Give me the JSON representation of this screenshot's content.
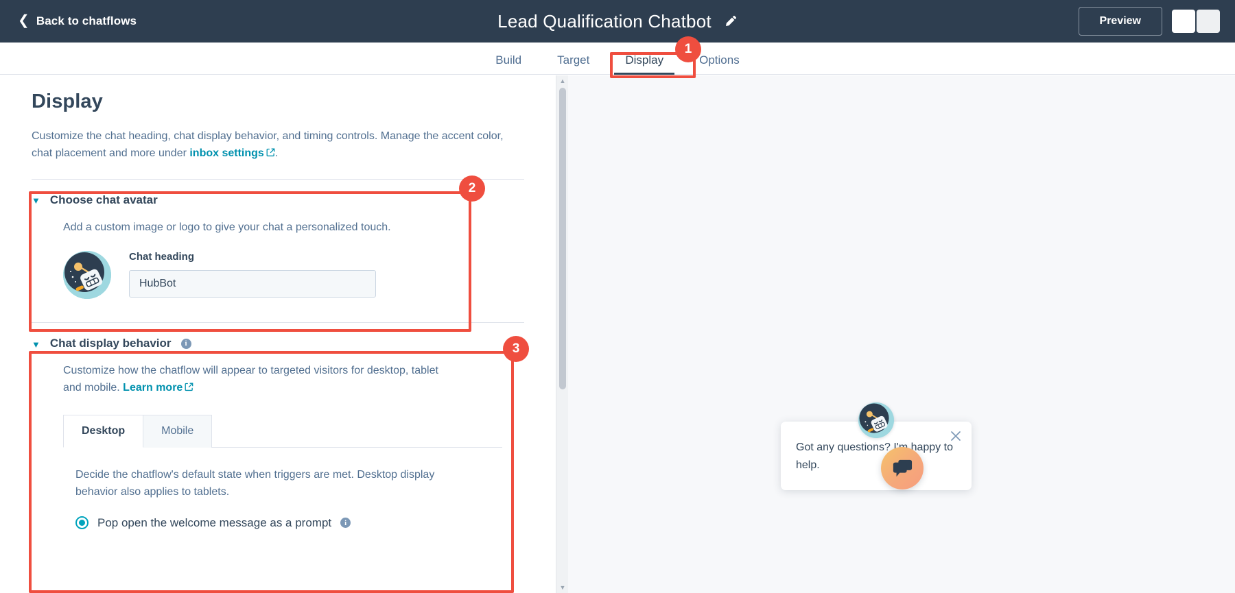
{
  "topbar": {
    "back_label": "Back to chatflows",
    "back_icon": "chevron-left-icon",
    "title": "Lead Qualification Chatbot",
    "edit_icon": "pencil-icon",
    "preview_label": "Preview"
  },
  "tabs": [
    {
      "label": "Build",
      "active": false
    },
    {
      "label": "Target",
      "active": false
    },
    {
      "label": "Display",
      "active": true
    },
    {
      "label": "Options",
      "active": false
    }
  ],
  "panel": {
    "page_title": "Display",
    "description_part1": "Customize the chat heading, chat display behavior, and timing controls. Manage the accent color, chat placement and more under ",
    "description_link": "inbox settings",
    "description_part2": ".",
    "sections": [
      {
        "title": "Choose chat avatar",
        "description": "Add a custom image or logo to give your chat a personalized touch.",
        "field_label": "Chat heading",
        "field_value": "HubBot",
        "field_placeholder": "Chat heading"
      },
      {
        "title": "Chat display behavior",
        "description_part1": "Customize how the chatflow will appear to targeted visitors for desktop, tablet and mobile. ",
        "description_link": "Learn more",
        "subtabs": [
          {
            "label": "Desktop",
            "active": true
          },
          {
            "label": "Mobile",
            "active": false
          }
        ],
        "pane_text": "Decide the chatflow's default state when triggers are met. Desktop display behavior also applies to tablets.",
        "radio_label": "Pop open the welcome message as a prompt"
      }
    ]
  },
  "preview": {
    "prompt_message": "Got any questions? I'm happy to help.",
    "close_icon": "close-icon",
    "avatar_icon": "robot-avatar-icon",
    "fab_icon": "chat-bubble-icon"
  },
  "annotations": [
    {
      "number": "1"
    },
    {
      "number": "2"
    },
    {
      "number": "3"
    }
  ],
  "colors": {
    "topbar_bg": "#2e3e50",
    "accent_link": "#0091ae",
    "annotation_red": "#ef4e3f",
    "radio_teal": "#00a4bd"
  }
}
